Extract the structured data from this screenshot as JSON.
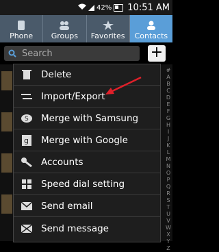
{
  "status": {
    "battery": "42%",
    "time": "10:51 AM"
  },
  "tabs": [
    {
      "label": "Phone",
      "icon": "phone-icon"
    },
    {
      "label": "Groups",
      "icon": "groups-icon"
    },
    {
      "label": "Favorites",
      "icon": "star-icon"
    },
    {
      "label": "Contacts",
      "icon": "contact-icon",
      "active": true
    }
  ],
  "search": {
    "placeholder": "Search",
    "add_label": "+"
  },
  "menu": {
    "items": [
      {
        "label": "Delete",
        "icon": "trash-icon"
      },
      {
        "label": "Import/Export",
        "icon": "import-export-icon"
      },
      {
        "label": "Merge with Samsung",
        "icon": "samsung-icon"
      },
      {
        "label": "Merge with Google",
        "icon": "google-icon"
      },
      {
        "label": "Accounts",
        "icon": "key-icon"
      },
      {
        "label": "Speed dial setting",
        "icon": "speed-dial-icon"
      },
      {
        "label": "Send email",
        "icon": "email-icon"
      },
      {
        "label": "Send message",
        "icon": "message-icon"
      }
    ]
  },
  "alphabet": [
    "#",
    "A",
    "B",
    "C",
    "D",
    "E",
    "F",
    "G",
    "H",
    "I",
    "J",
    "K",
    "L",
    "M",
    "N",
    "O",
    "P",
    "Q",
    "R",
    "S",
    "T",
    "U",
    "V",
    "W",
    "X",
    "Y",
    "Z"
  ],
  "colors": {
    "tab_bg": "#4a5a6a",
    "tab_active": "#5a9ed8",
    "menu_bg": "#1e1e1e",
    "arrow": "#e0202a"
  }
}
